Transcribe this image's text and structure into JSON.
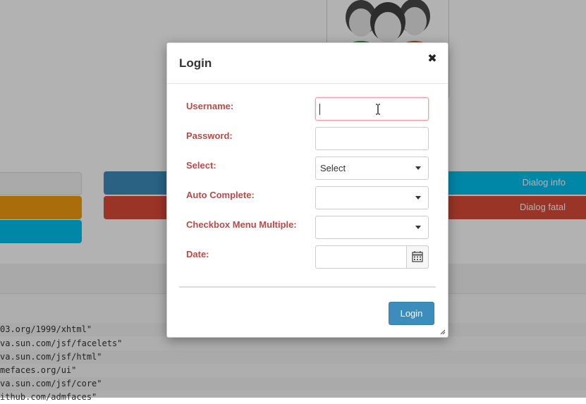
{
  "background": {
    "buttons": {
      "dialog_info": "Dialog info",
      "dialog_fatal": "Dialog fatal"
    },
    "code_lines": [
      "03.org/1999/xhtml\"",
      "va.sun.com/jsf/facelets\"",
      "va.sun.com/jsf/html\"",
      "mefaces.org/ui\"",
      "va.sun.com/jsf/core\"",
      "ithub.com/admfaces\""
    ],
    "avatar_icon": "users-group-icon"
  },
  "dialog": {
    "title": "Login",
    "close_icon": "close-icon",
    "fields": {
      "username": {
        "label": "Username:",
        "value": ""
      },
      "password": {
        "label": "Password:",
        "value": ""
      },
      "select": {
        "label": "Select:",
        "value": "Select"
      },
      "autocomplete": {
        "label": "Auto Complete:",
        "value": ""
      },
      "checkbox_menu": {
        "label": "Checkbox Menu Multiple:",
        "value": ""
      },
      "date": {
        "label": "Date:",
        "value": "",
        "icon": "calendar-icon"
      }
    },
    "submit_label": "Login"
  },
  "colors": {
    "label_red": "#b94a48",
    "primary": "#3c8dbc",
    "info": "#00c0ef",
    "danger": "#dd4b39",
    "warning": "#f39c12"
  }
}
